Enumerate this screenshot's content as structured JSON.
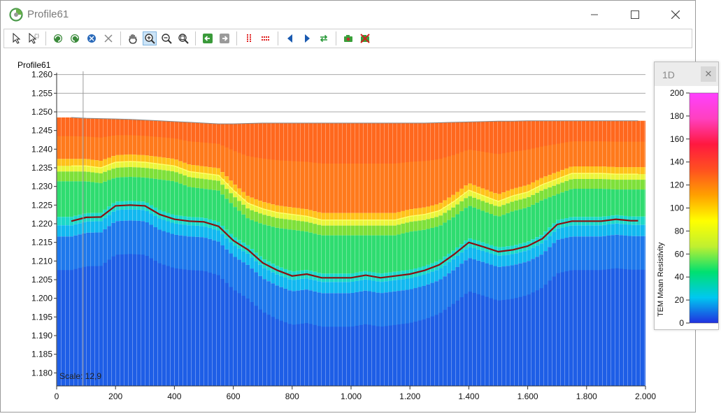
{
  "window": {
    "title": "Profile61"
  },
  "toolbar": {
    "groups": [
      [
        "select-arrow-icon",
        "select-multi-icon"
      ],
      [
        "rotate-left-icon",
        "rotate-right-icon",
        "select-region-icon",
        "delete-x-icon"
      ],
      [
        "hand-pan-icon",
        "zoom-in-icon",
        "zoom-out-icon",
        "zoom-extent-icon"
      ],
      [
        "arrow-left-icon",
        "arrow-right-icon"
      ],
      [
        "vertical-lines-icon",
        "horizontal-lines-icon"
      ],
      [
        "triangle-left-icon",
        "triangle-right-icon",
        "swap-arrows-icon"
      ],
      [
        "camera-icon",
        "camera-cancel-icon"
      ]
    ],
    "active_tool": "zoom-in-icon"
  },
  "plot": {
    "profile_label": "Profile61",
    "scale_label": "Scale: 12,9",
    "y_ticks": [
      "1.260",
      "1.255",
      "1.250",
      "1.245",
      "1.240",
      "1.235",
      "1.230",
      "1.225",
      "1.220",
      "1.215",
      "1.210",
      "1.205",
      "1.200",
      "1.195",
      "1.190",
      "1.185",
      "1.180"
    ],
    "x_ticks": [
      "0",
      "200",
      "400",
      "600",
      "800",
      "1.000",
      "1.200",
      "1.400",
      "1.600",
      "1.800",
      "2.000"
    ]
  },
  "legend_panel": {
    "title": "1D",
    "close_label": "✕",
    "axis_label": "TEM Mean Resistivity",
    "ticks": [
      "200",
      "180",
      "160",
      "140",
      "120",
      "100",
      "80",
      "60",
      "40",
      "20",
      "0"
    ],
    "colors": [
      "#2030e0",
      "#00c8f0",
      "#00e070",
      "#c0f030",
      "#ffff00",
      "#ffa000",
      "#ff5020",
      "#ff1840",
      "#ff40c0",
      "#ff40ff"
    ]
  },
  "chart_data": {
    "type": "heatmap",
    "x": [
      50,
      100,
      150,
      200,
      250,
      300,
      350,
      400,
      450,
      500,
      550,
      600,
      650,
      700,
      750,
      800,
      850,
      900,
      950,
      1000,
      1050,
      1100,
      1150,
      1200,
      1250,
      1300,
      1350,
      1400,
      1450,
      1500,
      1550,
      1600,
      1650,
      1700,
      1750,
      1800,
      1850,
      1900,
      1950,
      1975
    ],
    "series": [
      {
        "values": [
          1.2207,
          1.2217,
          1.2218,
          1.2248,
          1.225,
          1.2248,
          1.2225,
          1.2212,
          1.2207,
          1.2205,
          1.2193,
          1.2155,
          1.213,
          1.2095,
          1.2075,
          1.206,
          1.2065,
          1.2055,
          1.2055,
          1.2055,
          1.2062,
          1.2055,
          1.206,
          1.2065,
          1.2075,
          1.209,
          1.2118,
          1.215,
          1.2138,
          1.2125,
          1.213,
          1.214,
          1.216,
          1.2198,
          1.2207,
          1.2207,
          1.2207,
          1.2212,
          1.2208,
          1.2208
        ]
      },
      {
        "values": [
          1.2355,
          1.2355,
          1.235,
          1.2365,
          1.2367,
          1.2365,
          1.236,
          1.2355,
          1.234,
          1.2335,
          1.233,
          1.229,
          1.2255,
          1.224,
          1.223,
          1.2225,
          1.222,
          1.221,
          1.221,
          1.221,
          1.221,
          1.221,
          1.221,
          1.222,
          1.2225,
          1.2235,
          1.226,
          1.229,
          1.2275,
          1.226,
          1.2275,
          1.2285,
          1.2305,
          1.232,
          1.2335,
          1.2335,
          1.2335,
          1.2333,
          1.2333,
          1.2333
        ]
      }
    ],
    "surface": [
      1.2485,
      1.2483,
      1.2482,
      1.2481,
      1.248,
      1.2478,
      1.2476,
      1.2474,
      1.2472,
      1.247,
      1.2468,
      1.2468,
      1.2469,
      1.247,
      1.247,
      1.247,
      1.247,
      1.247,
      1.247,
      1.247,
      1.247,
      1.247,
      1.247,
      1.247,
      1.247,
      1.2471,
      1.2472,
      1.2473,
      1.2474,
      1.2475,
      1.2475,
      1.2476,
      1.2476,
      1.2476,
      1.2476,
      1.2476,
      1.2476,
      1.2476,
      1.2476,
      1.2476
    ],
    "xlim": [
      0,
      2000
    ],
    "ylim": [
      1.1765,
      1.2605
    ],
    "colorbar": {
      "label": "TEM Mean Resistivity",
      "range": [
        0,
        200
      ]
    }
  }
}
